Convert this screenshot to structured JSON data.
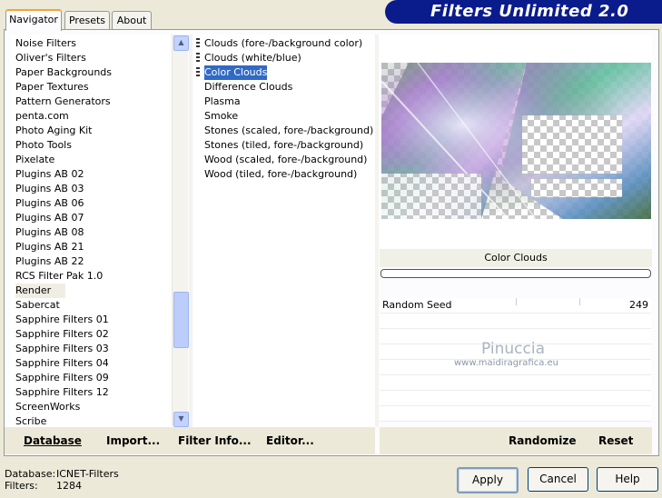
{
  "tabs": [
    "Navigator",
    "Presets",
    "About"
  ],
  "banner_title": "Filters Unlimited 2.0",
  "categories": [
    "Noise Filters",
    "Oliver's Filters",
    "Paper Backgrounds",
    "Paper Textures",
    "Pattern Generators",
    "penta.com",
    "Photo Aging Kit",
    "Photo Tools",
    "Pixelate",
    "Plugins AB 02",
    "Plugins AB 03",
    "Plugins AB 06",
    "Plugins AB 07",
    "Plugins AB 08",
    "Plugins AB 21",
    "Plugins AB 22",
    "RCS Filter Pak 1.0",
    "Render",
    "Sabercat",
    "Sapphire Filters 01",
    "Sapphire Filters 02",
    "Sapphire Filters 03",
    "Sapphire Filters 04",
    "Sapphire Filters 09",
    "Sapphire Filters 12",
    "ScreenWorks",
    "Scribe"
  ],
  "selected_category": "Render",
  "filters": [
    "Clouds (fore-/background color)",
    "Clouds (white/blue)",
    "Color Clouds",
    "Difference Clouds",
    "Plasma",
    "Smoke",
    "Stones (scaled, fore-/background)",
    "Stones (tiled, fore-/background)",
    "Wood (scaled, fore-/background)",
    "Wood (tiled, fore-/background)"
  ],
  "selected_filter": "Color Clouds",
  "preview_title": "Color Clouds",
  "param": {
    "label": "Random Seed",
    "value": "249"
  },
  "watermark": {
    "name": "Pinuccia",
    "url": "www.maidiragrafica.eu"
  },
  "left_buttons": {
    "database": "Database",
    "import": "Import...",
    "filter_info": "Filter Info...",
    "editor": "Editor..."
  },
  "right_buttons": {
    "randomize": "Randomize",
    "reset": "Reset"
  },
  "status": {
    "database_label": "Database:",
    "database_value": "ICNET-Filters",
    "filters_label": "Filters:",
    "filters_value": "1284"
  },
  "dialog_buttons": {
    "apply": "Apply",
    "cancel": "Cancel",
    "help": "Help"
  }
}
